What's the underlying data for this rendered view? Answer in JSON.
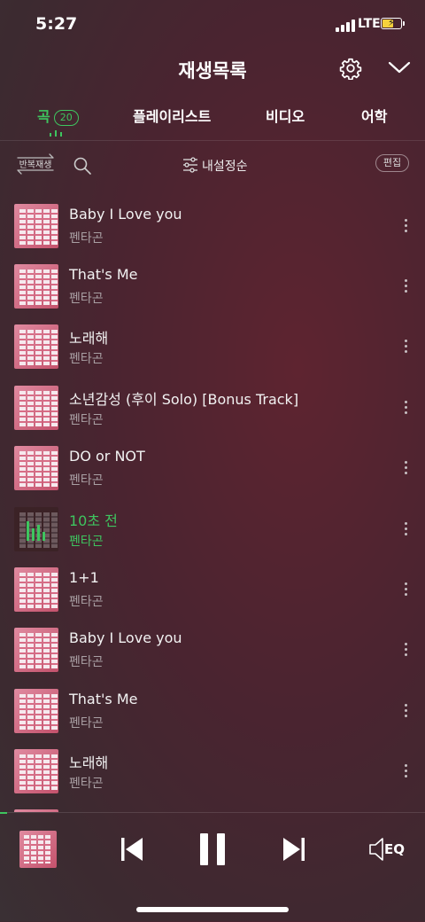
{
  "status_bar": {
    "time": "5:27",
    "network": "LTE",
    "battery_color": "#f5d23c"
  },
  "header": {
    "title": "재생목록",
    "settings_icon": "gear-icon",
    "collapse_icon": "chevron-down-icon"
  },
  "tabs": [
    {
      "label": "곡",
      "count": "20",
      "active": true
    },
    {
      "label": "플레이리스트",
      "active": false
    },
    {
      "label": "비디오",
      "active": false
    },
    {
      "label": "어학",
      "active": false
    }
  ],
  "toolbar": {
    "repeat_label": "반복재생",
    "search_icon": "search-icon",
    "sort_icon": "sliders-icon",
    "sort_label": "내설정순",
    "edit_label": "편집"
  },
  "songs": [
    {
      "title": "Baby I Love you",
      "artist": "펜타곤",
      "playing": false
    },
    {
      "title": "That's Me",
      "artist": "펜타곤",
      "playing": false
    },
    {
      "title": "노래해",
      "artist": "펜타곤",
      "playing": false
    },
    {
      "title": "소년감성 (후이 Solo) [Bonus Track]",
      "artist": "펜타곤",
      "playing": false
    },
    {
      "title": "DO or NOT",
      "artist": "펜타곤",
      "playing": false
    },
    {
      "title": "10초 전",
      "artist": "펜타곤",
      "playing": true
    },
    {
      "title": "1+1",
      "artist": "펜타곤",
      "playing": false
    },
    {
      "title": "Baby I Love you",
      "artist": "펜타곤",
      "playing": false
    },
    {
      "title": "That's Me",
      "artist": "펜타곤",
      "playing": false
    },
    {
      "title": "노래해",
      "artist": "펜타곤",
      "playing": false
    }
  ],
  "player": {
    "prev_icon": "skip-previous-icon",
    "pause_icon": "pause-icon",
    "next_icon": "skip-next-icon",
    "eq_label": "EQ"
  },
  "colors": {
    "accent": "#3ec55f",
    "background": "#4a2430"
  }
}
